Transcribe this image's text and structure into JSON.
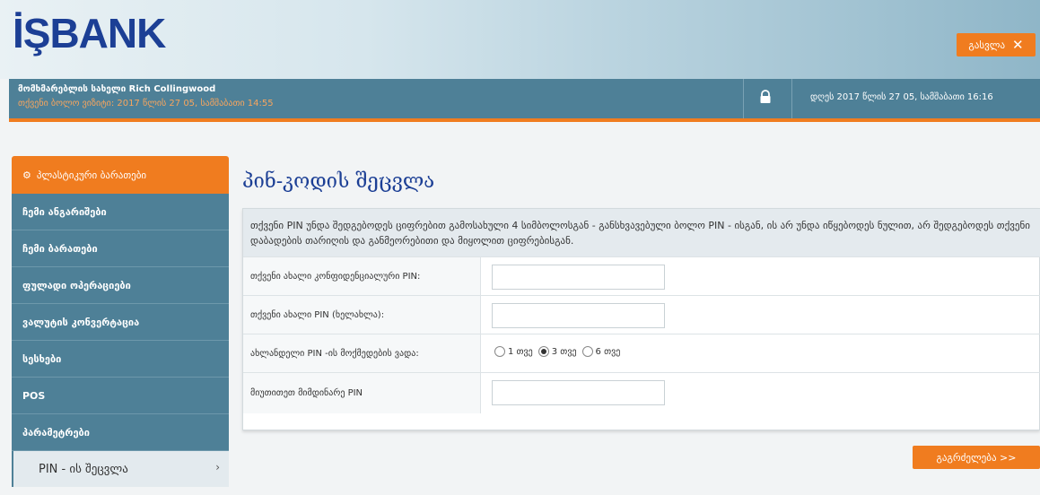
{
  "header": {
    "logo": "İŞBANK",
    "exit_label": "გასვლა",
    "exit_icon": "close-icon"
  },
  "infobar": {
    "user_line": "მომხმარებლის სახელი Rich Collingwood",
    "last_login": "თქვენი ბოლო ვიზიტი: 2017 წლის 27 05, სამშაბათი 14:55",
    "lock_icon": "lock-icon",
    "current_date": "დღეს 2017 წლის 27 05, სამშაბათი 16:16"
  },
  "sidebar": {
    "active": {
      "icon": "settings-icon",
      "label": "პლასტიკური ბარათები"
    },
    "items": [
      {
        "label": "ჩემი ანგარიშები"
      },
      {
        "label": "ჩემი ბარათები"
      },
      {
        "label": "ფულადი ოპერაციები"
      },
      {
        "label": "ვალუტის კონვერტაცია"
      },
      {
        "label": "სესხები"
      },
      {
        "label": "POS"
      },
      {
        "label": "პარამეტრები"
      }
    ],
    "sub_item": {
      "label": "PIN - ის შეცვლა",
      "icon": "chevron-right-icon"
    }
  },
  "main": {
    "title": "პინ-კოდის შეცვლა",
    "notice": "თქვენი PIN უნდა შედგებოდეს ციფრებით გამოსახული 4 სიმბოლოსგან - განსხვავებული ბოლო PIN - ისგან, ის არ უნდა იწყებოდეს ნულით, არ შედგებოდეს თქვენი დაბადების თარიღის და განმეორებითი და მიყოლით ციფრებისგან.",
    "fields": [
      {
        "label": "თქვენი ახალი კონფიდენციალური PIN:",
        "value": ""
      },
      {
        "label": "თქვენი ახალი PIN (ხელახლა):",
        "value": ""
      }
    ],
    "radio_label": "ახლანდელი PIN -ის მოქმედების ვადა:",
    "radio_options": [
      {
        "label": "1 თვე",
        "selected": false
      },
      {
        "label": "3 თვე",
        "selected": true
      },
      {
        "label": "6 თვე",
        "selected": false
      }
    ],
    "confirm_label": "მიუთითეთ მიმდინარე PIN",
    "confirm_value": "",
    "continue_label": "გაგრძელება >>"
  },
  "colors": {
    "accent": "#f07c1f",
    "brand": "#1c3f95",
    "sidebar": "#4e8097"
  }
}
